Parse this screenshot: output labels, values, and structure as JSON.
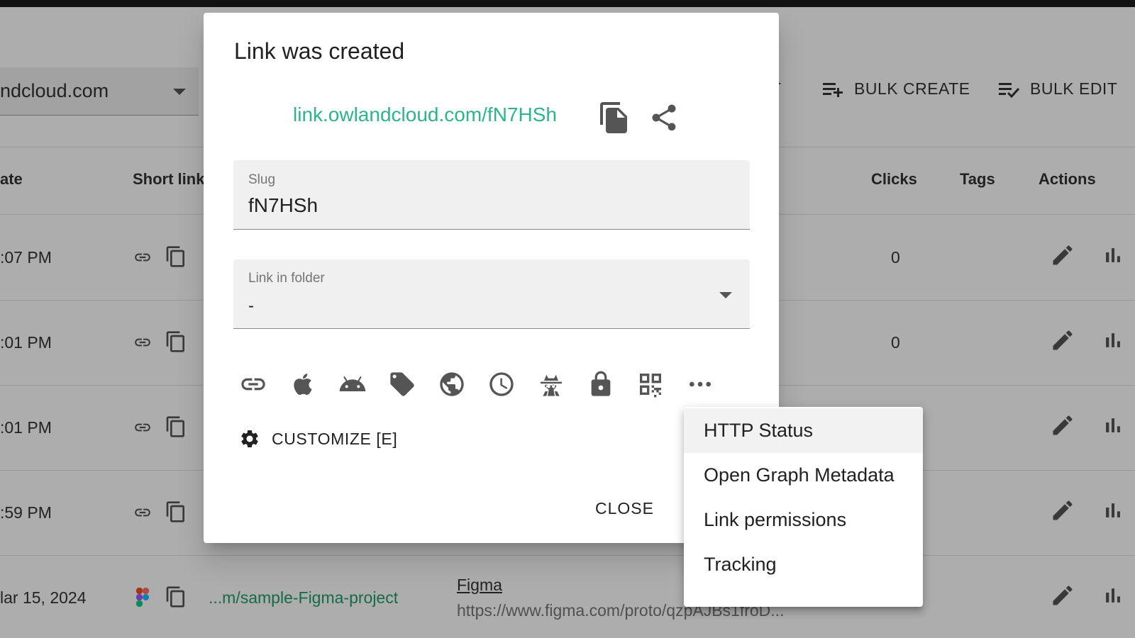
{
  "background": {
    "domain_select": {
      "value": "ndcloud.com"
    },
    "toolbar": {
      "export_label": "RT",
      "bulk_create_label": "BULK CREATE",
      "bulk_edit_label": "BULK EDIT"
    },
    "table": {
      "headers": {
        "date": "ate",
        "short_link": "Short link",
        "clicks": "Clicks",
        "tags": "Tags",
        "actions": "Actions"
      },
      "rows": [
        {
          "date": ":07 PM",
          "clicks": "0"
        },
        {
          "date": ":01 PM",
          "clicks": "0"
        },
        {
          "date": ":01 PM",
          "clicks": ""
        },
        {
          "date": ":59 PM",
          "clicks": ""
        },
        {
          "date": "lar 15, 2024",
          "short_link": "...m/sample-Figma-project",
          "title": "Figma",
          "long_url": "https://www.figma.com/proto/qzpAJBs1froD..."
        }
      ]
    }
  },
  "dialog": {
    "title": "Link was created",
    "short_url": "link.owlandcloud.com/fN7HSh",
    "slug": {
      "label": "Slug",
      "value": "fN7HSh"
    },
    "folder": {
      "label": "Link in folder",
      "value": "-"
    },
    "option_icons": [
      "link-icon",
      "apple-icon",
      "android-icon",
      "tag-icon",
      "globe-icon",
      "clock-icon",
      "spy-icon",
      "lock-icon",
      "qr-code-icon",
      "more-icon"
    ],
    "customize_label": "CUSTOMIZE [E]",
    "close_label": "CLOSE"
  },
  "menu": {
    "items": [
      "HTTP Status",
      "Open Graph Metadata",
      "Link permissions",
      "Tracking"
    ],
    "active_index": 0
  },
  "colors": {
    "link_green": "#2bb58a",
    "table_link_green": "#1e9e6a",
    "scrim": "rgba(0,0,0,0.32)"
  }
}
